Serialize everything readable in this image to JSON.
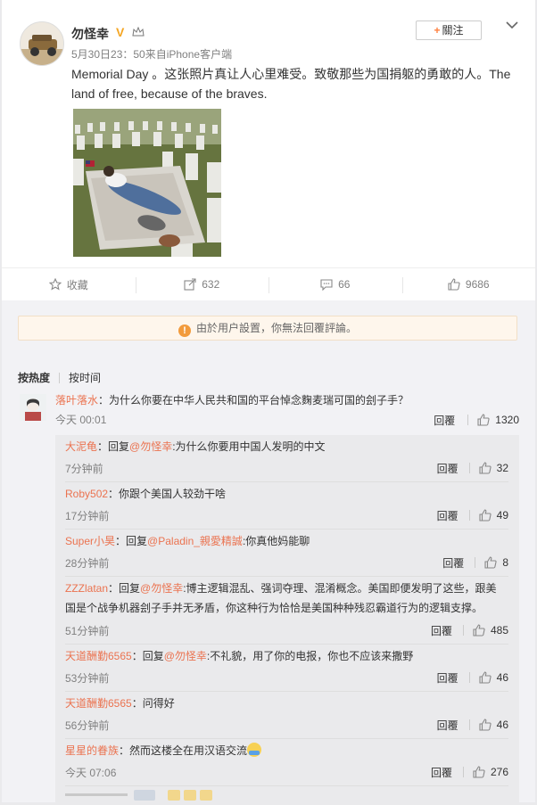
{
  "post": {
    "author": "勿怪幸",
    "meta": "5月30日23：50来自iPhone客户端",
    "follow_label": "關注",
    "text": "Memorial Day 。这张照片真让人心里难受。致敬那些为国捐躯的勇敢的人。The land of free, because of the braves."
  },
  "actions": {
    "collect": "收藏",
    "repost": "632",
    "comment": "66",
    "like": "9686"
  },
  "notice": "由於用户設置，你無法回覆評論。",
  "sort": {
    "hot": "按热度",
    "time": "按时间"
  },
  "top_comment": {
    "author": "落叶落水",
    "text": "：为什么你要在中华人民共和国的平台悼念麴麦瑞可国的刽子手？",
    "time": "今天 00:01",
    "reply": "回覆",
    "likes": "1320"
  },
  "replies": [
    {
      "author": "大泥龟",
      "pre": "：回复",
      "at": "@勿怪幸",
      "text": ":为什么你要用中国人发明的中文",
      "time": "7分钟前",
      "reply": "回覆",
      "likes": "32"
    },
    {
      "author": "Roby502",
      "pre": "：你跟个美国人较劲干啥",
      "at": "",
      "text": "",
      "time": "17分钟前",
      "reply": "回覆",
      "likes": "49"
    },
    {
      "author": "Super小昊",
      "pre": "：回复",
      "at": "@Paladin_親愛精誠",
      "text": ":你真他妈能聊",
      "time": "28分钟前",
      "reply": "回覆",
      "likes": "8"
    },
    {
      "author": "ZZZlatan",
      "pre": "：回复",
      "at": "@勿怪幸",
      "text": ":博主逻辑混乱、强词夺理、混淆概念。美国即便发明了这些，跟美国是个战争机器刽子手并无矛盾，你这种行为恰恰是美国种种残忍霸道行为的逻辑支撑。",
      "time": "51分钟前",
      "reply": "回覆",
      "likes": "485"
    },
    {
      "author": "天道酬勤6565",
      "pre": "：回复",
      "at": "@勿怪幸",
      "text": ":不礼貌，用了你的电报，你也不应该来撒野",
      "time": "53分钟前",
      "reply": "回覆",
      "likes": "46"
    },
    {
      "author": "天道酬勤6565",
      "pre": "：问得好",
      "at": "",
      "text": "",
      "time": "56分钟前",
      "reply": "回覆",
      "likes": "46"
    },
    {
      "author": "星星的眷族",
      "pre": "：然而这楼全在用汉语交流",
      "at": "",
      "text": "",
      "time": "今天 07:06",
      "reply": "回覆",
      "likes": "276",
      "emoji": "hug-emoji"
    }
  ],
  "colors": {
    "link": "#eb7350",
    "accent": "#ff8140",
    "muted": "#808080"
  }
}
